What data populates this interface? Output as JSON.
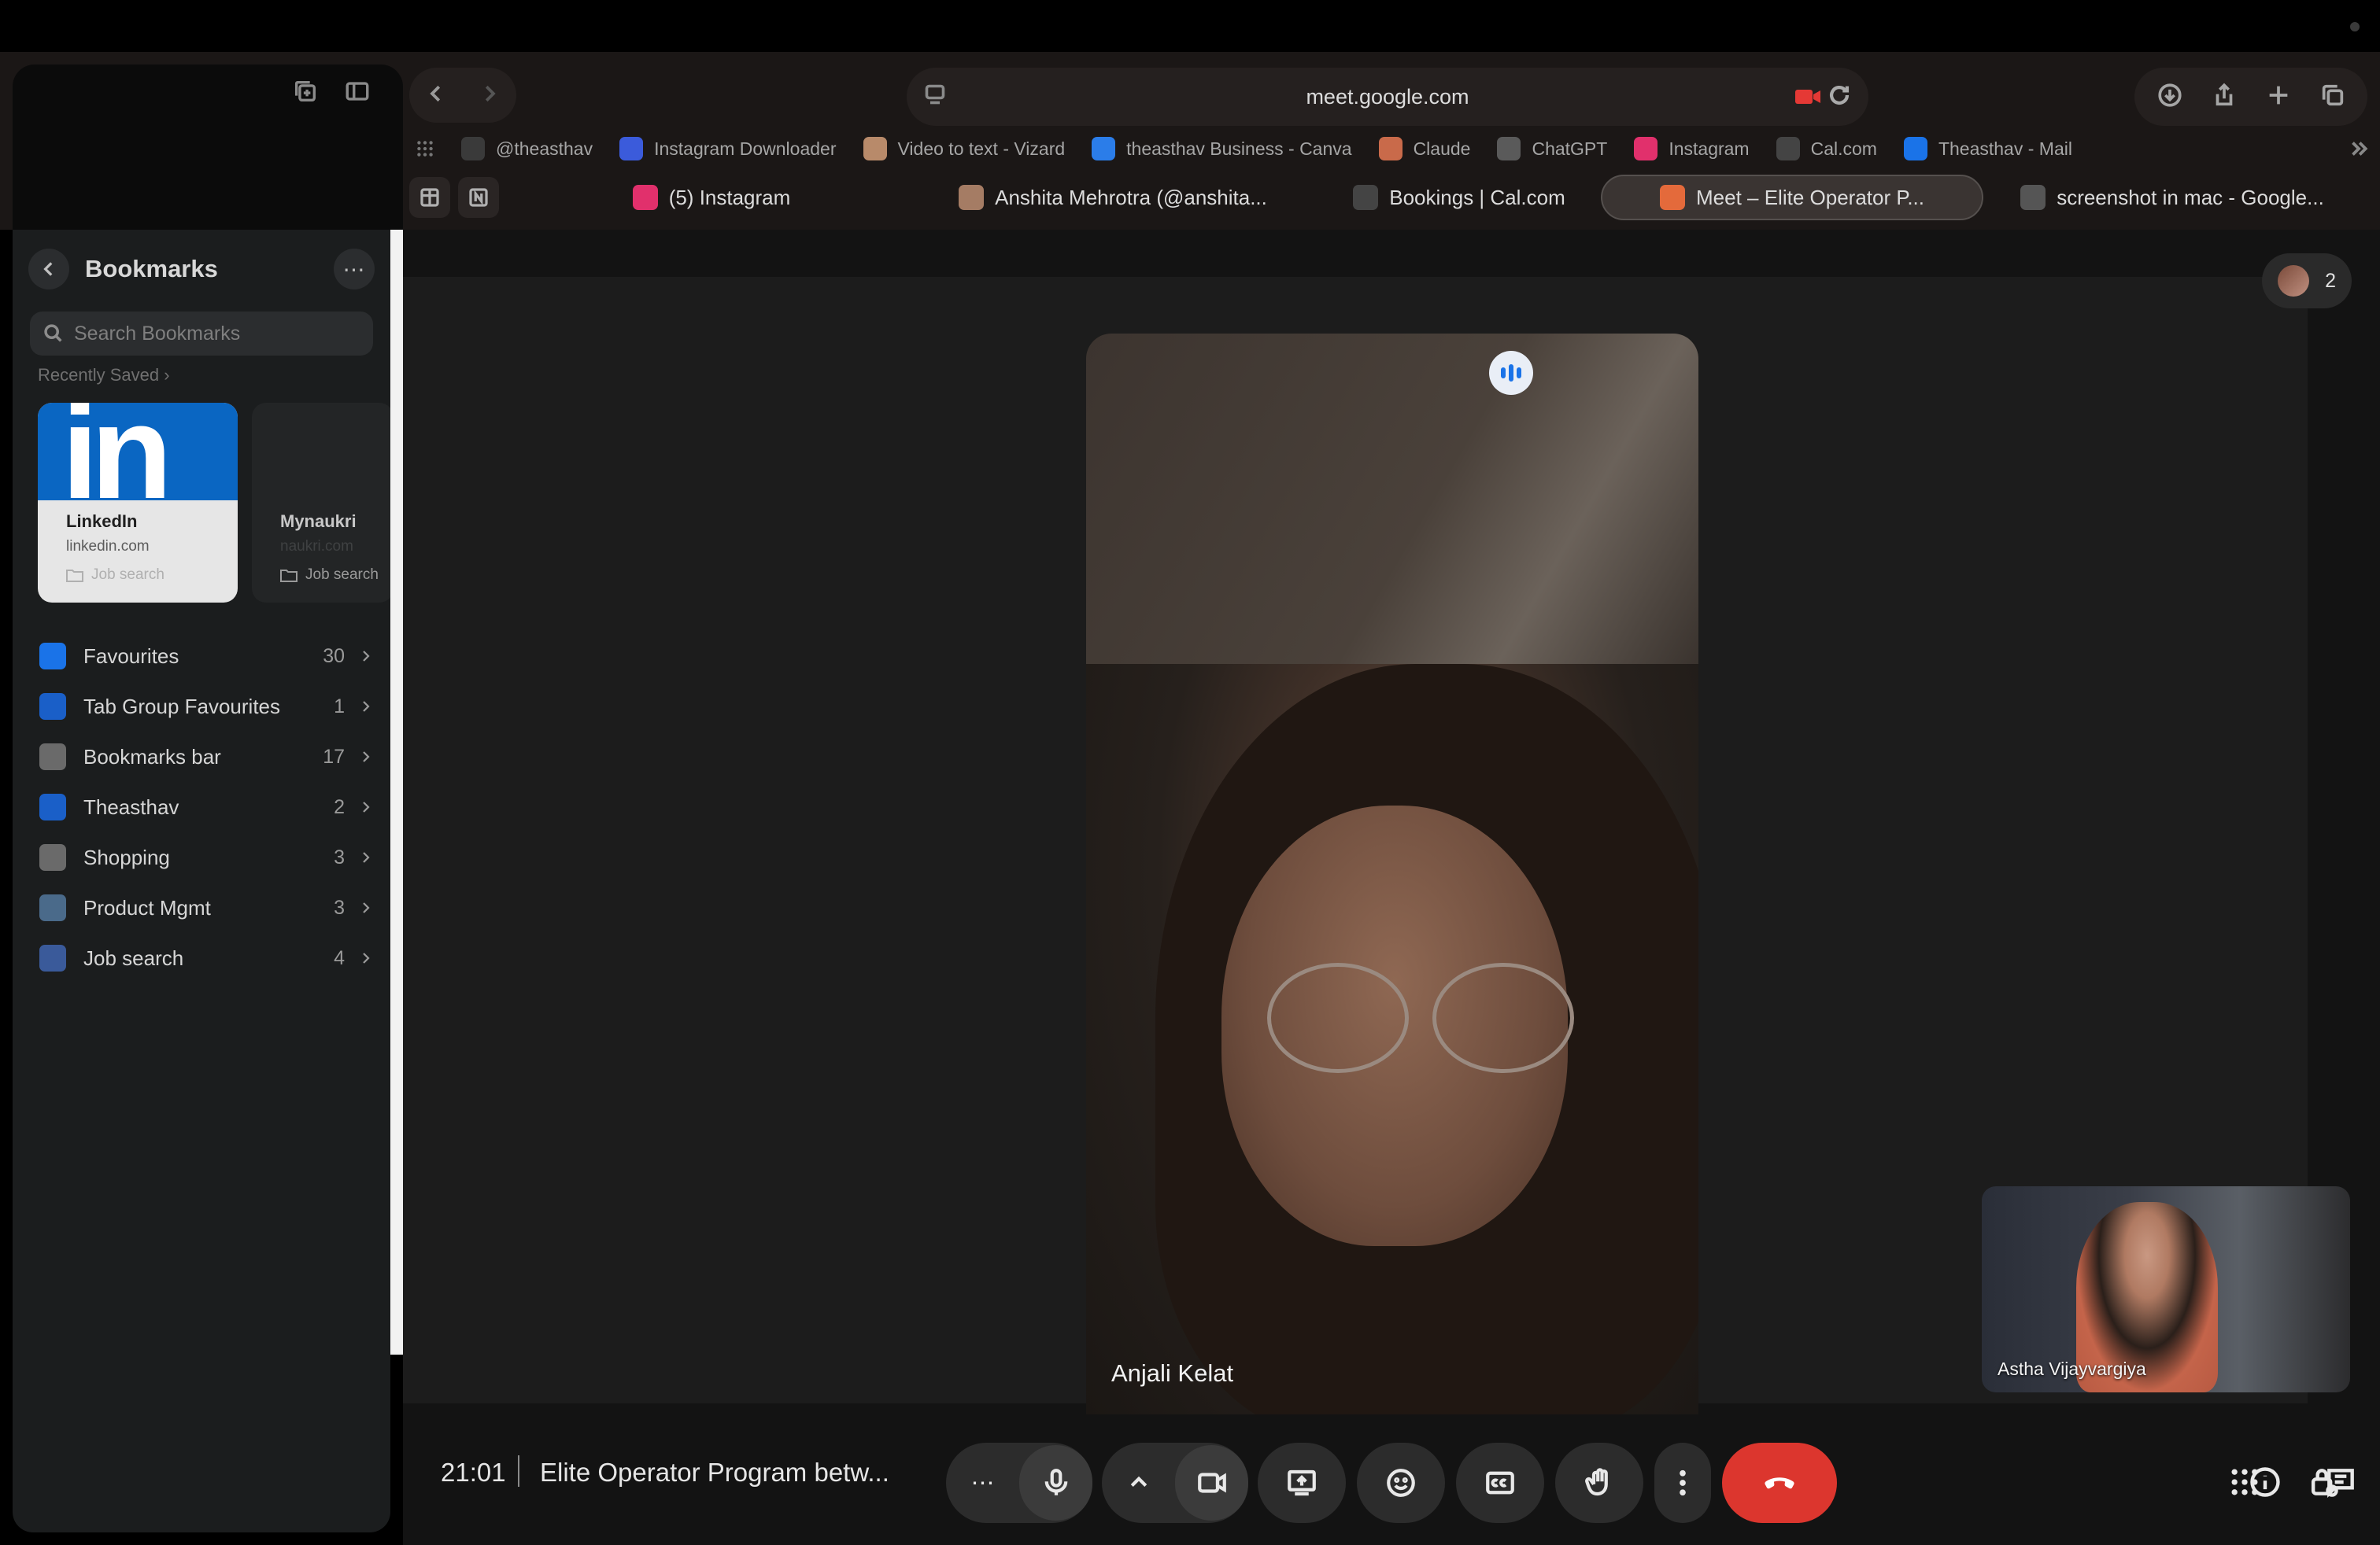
{
  "browser": {
    "url": "meet.google.com",
    "favorites": [
      {
        "label": "@theasthav",
        "icon": "globe-icon",
        "color": "#3a3a3a"
      },
      {
        "label": "Instagram Downloader",
        "icon": "diamond-icon",
        "color": "#3b5bdb"
      },
      {
        "label": "Video to text - Vizard",
        "icon": "asterisk-icon",
        "color": "#b88a6a"
      },
      {
        "label": "theasthav Business - Canva",
        "icon": "canva-icon",
        "color": "#2b7de9"
      },
      {
        "label": "Claude",
        "icon": "claude-icon",
        "color": "#c96a4a"
      },
      {
        "label": "ChatGPT",
        "icon": "chatgpt-icon",
        "color": "#5a5a5a"
      },
      {
        "label": "Instagram",
        "icon": "instagram-icon",
        "color": "#e1306c"
      },
      {
        "label": "Cal.com",
        "icon": "cal-icon",
        "color": "#444444"
      },
      {
        "label": "Theasthav - Mail",
        "icon": "mail-icon",
        "color": "#1a73e8"
      }
    ],
    "tabs": [
      {
        "label": "(5) Instagram",
        "icon": "instagram-icon",
        "color": "#e1306c",
        "active": false
      },
      {
        "label": "Anshita Mehrotra (@anshita...",
        "icon": "avatar-icon",
        "color": "#a57c64",
        "active": false
      },
      {
        "label": "Bookings | Cal.com",
        "icon": "cal-icon",
        "color": "#444444",
        "active": false
      },
      {
        "label": "Meet – Elite Operator P...",
        "icon": "meet-icon",
        "color": "#e46a3b",
        "active": true
      },
      {
        "label": "screenshot in mac - Google...",
        "icon": "google-icon",
        "color": "#555555",
        "active": false
      }
    ]
  },
  "sidebar": {
    "title": "Bookmarks",
    "search_placeholder": "Search Bookmarks",
    "recently_saved_label": "Recently Saved",
    "cards": [
      {
        "title": "LinkedIn",
        "domain": "linkedin.com",
        "folder": "Job search",
        "logo_text": "in"
      },
      {
        "title": "Mynaukri",
        "domain": "naukri.com",
        "folder": "Job search"
      }
    ],
    "items": [
      {
        "label": "Favourites",
        "count": "30",
        "icon": "star-icon",
        "color": "#1a73e8"
      },
      {
        "label": "Tab Group Favourites",
        "count": "1",
        "icon": "tab-group-icon",
        "color": "#1a5fc8"
      },
      {
        "label": "Bookmarks bar",
        "count": "17",
        "icon": "folder-grid-icon",
        "color": "#6a6a6a"
      },
      {
        "label": "Theasthav",
        "count": "2",
        "icon": "folder-icon",
        "color": "#1a5fc8"
      },
      {
        "label": "Shopping",
        "count": "3",
        "icon": "folder-grid-icon",
        "color": "#6a6a6a"
      },
      {
        "label": "Product Mgmt",
        "count": "3",
        "icon": "folder-grid-icon",
        "color": "#4a6a8a"
      },
      {
        "label": "Job search",
        "count": "4",
        "icon": "folder-grid-icon",
        "color": "#3a5a9a"
      }
    ]
  },
  "meet": {
    "participant_count": "2",
    "main_participant": "Anjali Kelat",
    "self_participant": "Astha Vijayvargiya",
    "time": "21:01",
    "separator": "|",
    "meeting_title": "Elite Operator Program betw...",
    "more_options_label": "⋯",
    "leave_color": "#dc362e",
    "speaking_color": "#1a73e8"
  }
}
